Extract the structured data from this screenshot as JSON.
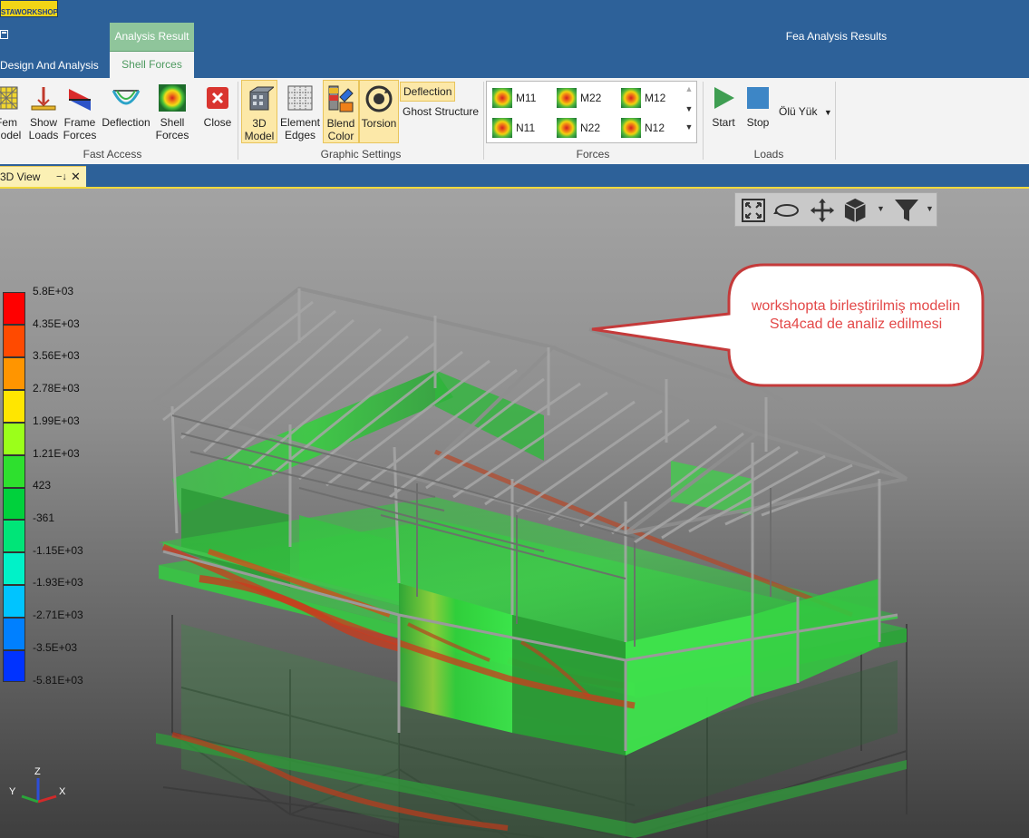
{
  "app": {
    "logo_text": "STAWORKSHOP",
    "window_title": "Fea Analysis Results",
    "context_tab_group": "Analysis Result",
    "tabs": [
      "Design And Analysis",
      "Shell Forces"
    ]
  },
  "ribbon": {
    "fast_access": {
      "label": "Fast Access",
      "buttons": [
        {
          "label": "Fem\nModel",
          "icon": "fem-model-icon"
        },
        {
          "label": "Show\nLoads",
          "icon": "show-loads-icon"
        },
        {
          "label": "Frame\nForces",
          "icon": "frame-forces-icon"
        },
        {
          "label": "Deflection",
          "icon": "deflection-icon"
        },
        {
          "label": "Shell\nForces",
          "icon": "shell-forces-icon"
        },
        {
          "label": "Close",
          "icon": "close-icon"
        }
      ]
    },
    "graphic_settings": {
      "label": "Graphic Settings",
      "buttons": [
        {
          "label": "3D\nModel",
          "icon": "3d-model-icon",
          "selected": true
        },
        {
          "label": "Element\nEdges",
          "icon": "element-edges-icon",
          "selected": false
        },
        {
          "label": "Blend\nColor",
          "icon": "blend-color-icon",
          "selected": true
        },
        {
          "label": "Torsion",
          "icon": "torsion-icon",
          "selected": true
        }
      ],
      "small_buttons": [
        {
          "label": "Deflection",
          "selected": true
        },
        {
          "label": "Ghost Structure",
          "selected": false
        }
      ]
    },
    "forces": {
      "label": "Forces",
      "items": [
        "M11",
        "M22",
        "M12",
        "N11",
        "N22",
        "N12"
      ]
    },
    "loads": {
      "label": "Loads",
      "start_label": "Start",
      "stop_label": "Stop",
      "load_case": "Ölü Yük"
    }
  },
  "document_tab": {
    "label": "3D View",
    "pin": "−↓",
    "close": "✕"
  },
  "legend": {
    "values": [
      "5.8E+03",
      "4.35E+03",
      "3.56E+03",
      "2.78E+03",
      "1.99E+03",
      "1.21E+03",
      "423",
      "-361",
      "-1.15E+03",
      "-1.93E+03",
      "-2.71E+03",
      "-3.5E+03",
      "-5.81E+03"
    ],
    "colors": [
      "#ff0000",
      "#ff4a00",
      "#ff9500",
      "#ffe600",
      "#9bff1a",
      "#2ee02e",
      "#00d13c",
      "#00e578",
      "#00f2c8",
      "#00c4ff",
      "#0080ff",
      "#0033ff",
      "#0000e0"
    ]
  },
  "callout": {
    "text": "workshopta birleştirilmiş modelin Sta4cad de analiz edilmesi",
    "color": "#e34848"
  },
  "axes": {
    "z": "Z",
    "y": "Y",
    "x": "X"
  }
}
